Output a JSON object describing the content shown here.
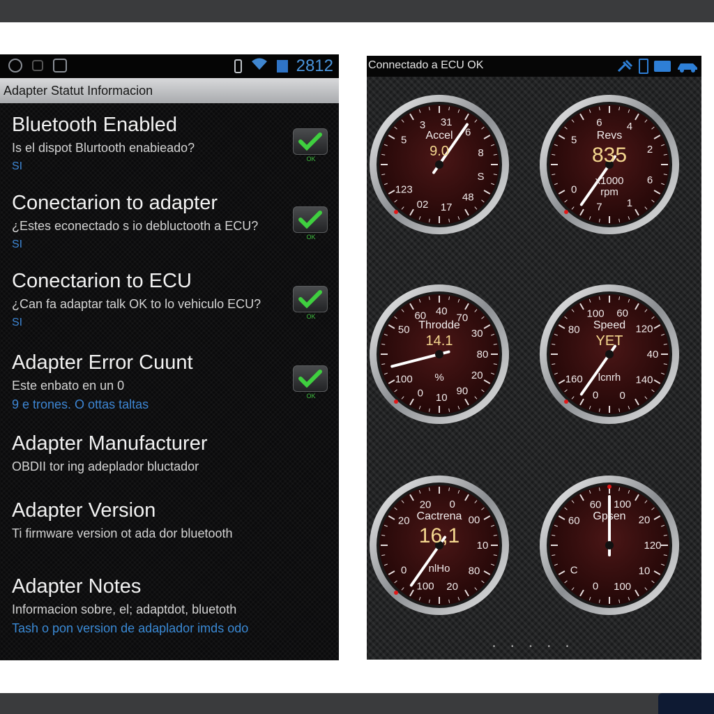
{
  "left_screen": {
    "status_bar": {
      "time": "2812",
      "icons": [
        "mic-icon",
        "image-icon",
        "screenshot-icon",
        "battery-icon",
        "wifi-icon",
        "signal-icon"
      ]
    },
    "title": "Adapter Statut Informacion",
    "items": [
      {
        "title": "Bluetooth Enabled",
        "desc": "Is el dispot Blurtooth enabieado?",
        "value": "SI",
        "check": "OK"
      },
      {
        "title": "Conectarion to adapter",
        "desc": "¿Estes econectado s io debluctooth a ECU?",
        "value": "SI",
        "check": "OK"
      },
      {
        "title": "Conectarion to ECU",
        "desc": "¿Can fa adaptar talk OK to lo vehiculo ECU?",
        "value": "SI",
        "check": "OK"
      },
      {
        "title": "Adapter Error Cuunt",
        "desc": "Este enbato en un 0",
        "value": "9 e trones. O ottas taltas",
        "check": "OK"
      },
      {
        "title": "Adapter Manufacturer",
        "desc": "OBDII tor ing adeplador bluctador"
      },
      {
        "title": "Adapter Version",
        "desc": "Ti firmware version ot ada dor  bluetooth"
      },
      {
        "title": "Adapter Notes",
        "desc": "Informacion sobre, el; adaptdot, bluetoth",
        "value": "Tash o pon version de adaplador imds odo"
      }
    ]
  },
  "right_screen": {
    "status": "Connectado a ECU OK",
    "status_icons": [
      "satellite-icon",
      "phone-icon",
      "adapter-icon",
      "car-icon"
    ],
    "gauges": [
      {
        "label": "Accel",
        "value": "9.0",
        "unit": "",
        "ticks": [
          "5",
          "3",
          "31",
          "6",
          "8",
          "S",
          "48",
          "17",
          "02",
          "123"
        ],
        "needle_level": 0.62
      },
      {
        "label": "Revs",
        "value": "835",
        "unit": "x1000\nrpm",
        "ticks": [
          "5",
          "6",
          "4",
          "2",
          "6",
          "1",
          "7",
          "0"
        ],
        "needle_level": 0.0
      },
      {
        "label": "Throdde",
        "value": "14.1",
        "unit": "%",
        "ticks": [
          "50",
          "60",
          "40",
          "70",
          "30",
          "80",
          "20",
          "90",
          "10",
          "0",
          "100"
        ],
        "needle_level": 0.14
      },
      {
        "label": "Speed",
        "value": "YET",
        "unit": "lcnrh",
        "ticks": [
          "80",
          "100",
          "60",
          "120",
          "40",
          "140",
          "0",
          "0",
          "160"
        ],
        "needle_level": 0.0
      },
      {
        "label": "Cactrena",
        "value": "16,1",
        "unit": "nlHo",
        "ticks": [
          "20",
          "20",
          "0",
          "00",
          "10",
          "80",
          "20",
          "100",
          "0"
        ],
        "needle_level": 0.0
      },
      {
        "label": "Gpsen",
        "value": "",
        "unit": "",
        "ticks": [
          "60",
          "60",
          "100",
          "20",
          "120",
          "10",
          "100",
          "0",
          "C"
        ],
        "needle_level": 0.5
      }
    ]
  }
}
